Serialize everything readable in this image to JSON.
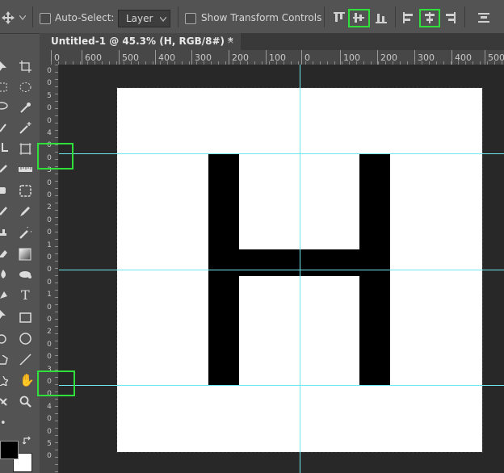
{
  "options_bar": {
    "auto_select_label": "Auto-Select:",
    "layer_dropdown_value": "Layer",
    "show_transform_label": "Show Transform Controls"
  },
  "document": {
    "tab_title": "Untitled-1 @ 45.3% (H, RGB/8#) *",
    "close_glyph": "×",
    "letter": "H"
  },
  "ruler": {
    "horizontal_labels": [
      "0",
      "600",
      "500",
      "400",
      "300",
      "200",
      "100",
      "0",
      "100",
      "200",
      "300",
      "400",
      "500"
    ],
    "vertical_labels": [
      "0",
      "0",
      "5",
      "0",
      "0",
      "4",
      "0",
      "0",
      "3",
      "0",
      "0",
      "2",
      "0",
      "0",
      "1",
      "0",
      "0",
      "0",
      "1",
      "0",
      "0",
      "2",
      "0",
      "0",
      "3",
      "0",
      "0",
      "4",
      "0",
      "0",
      "5",
      "0"
    ]
  },
  "toolbar": {
    "type_tool_glyph": "T",
    "hand_tool_glyph": "✋",
    "zoom_tool_glyph": "🔍"
  },
  "colors": {
    "guide": "#6ee9ee",
    "highlight": "#2fe03a",
    "pasteboard": "#282828",
    "panel": "#535353"
  },
  "icons": [
    "move-tool-icon",
    "align-top-icon",
    "align-vertical-center-icon",
    "align-bottom-icon",
    "align-left-icon",
    "align-horizontal-center-icon",
    "align-right-icon",
    "distribute-icon"
  ]
}
